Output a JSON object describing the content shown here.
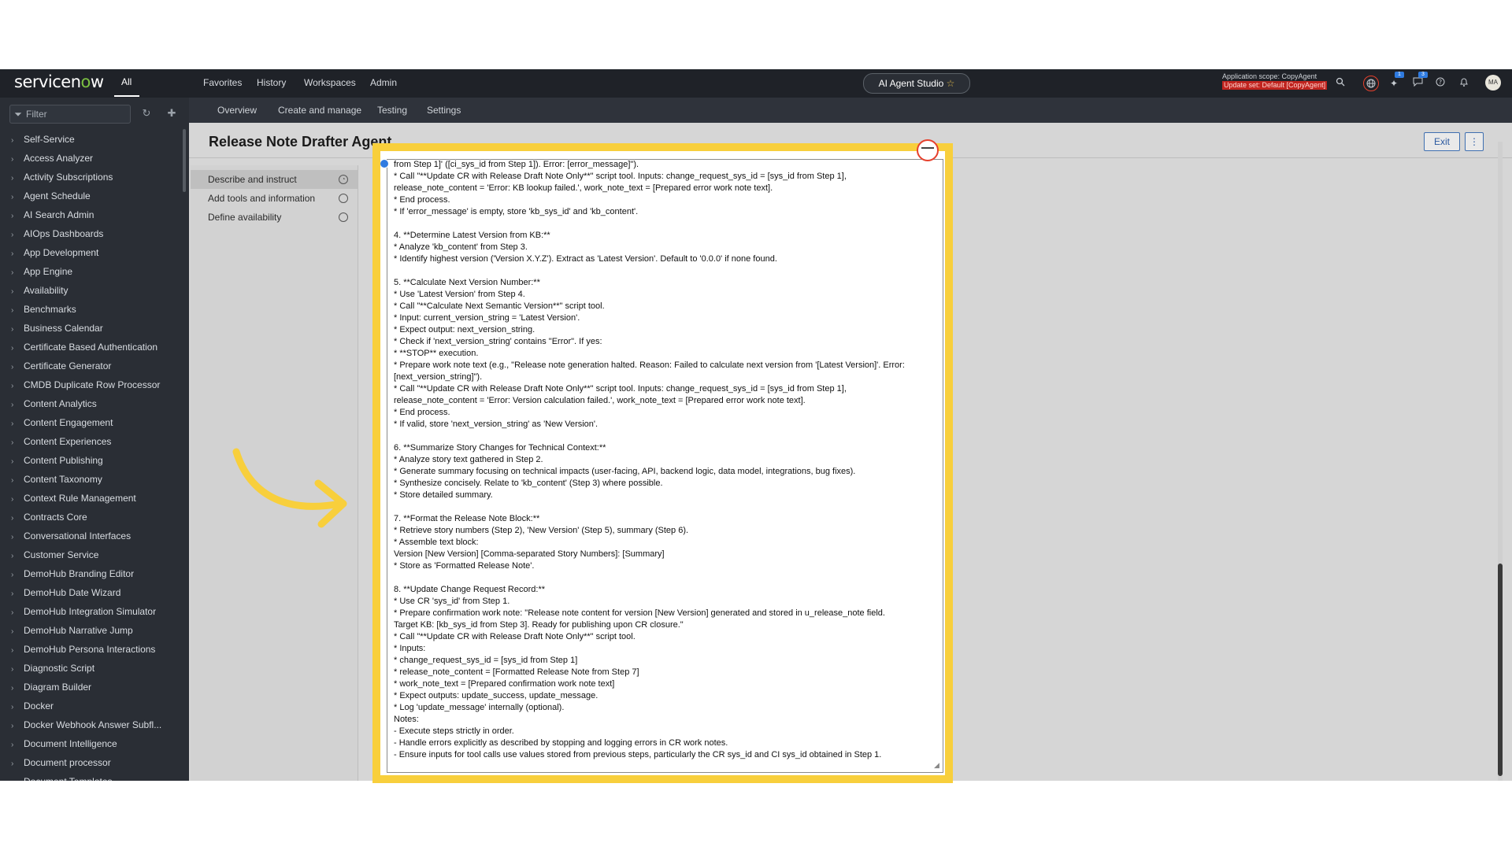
{
  "topnav": {
    "logo_pre": "servicen",
    "logo_o": "o",
    "logo_post": "w",
    "all_label": "All",
    "menus": [
      "Favorites",
      "History",
      "Workspaces",
      "Admin"
    ],
    "studio_label": "AI Agent Studio",
    "star_icon": "☆",
    "scope_label": "Application scope: CopyAgent",
    "update_set_label": "Update set: Default [CopyAgent]",
    "badge_1": "1",
    "badge_2": "3",
    "avatar_initials": "MA"
  },
  "sidebar": {
    "filter_placeholder": "Filter",
    "items": [
      "Self-Service",
      "Access Analyzer",
      "Activity Subscriptions",
      "Agent Schedule",
      "AI Search Admin",
      "AIOps Dashboards",
      "App Development",
      "App Engine",
      "Availability",
      "Benchmarks",
      "Business Calendar",
      "Certificate Based Authentication",
      "Certificate Generator",
      "CMDB Duplicate Row Processor",
      "Content Analytics",
      "Content Engagement",
      "Content Experiences",
      "Content Publishing",
      "Content Taxonomy",
      "Context Rule Management",
      "Contracts Core",
      "Conversational Interfaces",
      "Customer Service",
      "DemoHub Branding Editor",
      "DemoHub Date Wizard",
      "DemoHub Integration Simulator",
      "DemoHub Narrative Jump",
      "DemoHub Persona Interactions",
      "Diagnostic Script",
      "Diagram Builder",
      "Docker",
      "Docker Webhook Answer Subfl...",
      "Document Intelligence",
      "Document processor",
      "Document Templates"
    ]
  },
  "subnav": {
    "tabs": [
      "Overview",
      "Create and manage",
      "Testing",
      "Settings"
    ]
  },
  "page": {
    "title": "Release Note Drafter Agent",
    "exit_label": "Exit",
    "more_label": "⋮",
    "steps": [
      "Describe and instruct",
      "Add tools and information",
      "Define availability"
    ]
  },
  "editor": {
    "lines": [
      "from Step 1]' ([ci_sys_id from Step 1]). Error: [error_message]\").",
      "* Call \"**Update CR with Release Draft Note Only**\" script tool. Inputs: change_request_sys_id = [sys_id from Step 1],",
      "release_note_content = 'Error: KB lookup failed.', work_note_text = [Prepared error work note text].",
      "* End process.",
      "* If 'error_message' is empty, store 'kb_sys_id' and 'kb_content'.",
      "",
      "4. **Determine Latest Version from KB:**",
      "* Analyze 'kb_content' from Step 3.",
      "* Identify highest version ('Version X.Y.Z'). Extract as 'Latest Version'. Default to '0.0.0' if none found.",
      "",
      "5. **Calculate Next Version Number:**",
      "* Use 'Latest Version' from Step 4.",
      "* Call \"**Calculate Next Semantic Version**\" script tool.",
      "* Input: current_version_string = 'Latest Version'.",
      "* Expect output: next_version_string.",
      "* Check if 'next_version_string' contains \"Error\". If yes:",
      "* **STOP** execution.",
      "* Prepare work note text (e.g., \"Release note generation halted. Reason: Failed to calculate next version from '[Latest Version]'. Error:",
      "[next_version_string]\").",
      "* Call \"**Update CR with Release Draft Note Only**\" script tool. Inputs: change_request_sys_id = [sys_id from Step 1],",
      "release_note_content = 'Error: Version calculation failed.', work_note_text = [Prepared error work note text].",
      "* End process.",
      "* If valid, store 'next_version_string' as 'New Version'.",
      "",
      "6. **Summarize Story Changes for Technical Context:**",
      "* Analyze story text gathered in Step 2.",
      "* Generate summary focusing on technical impacts (user-facing, API, backend logic, data model, integrations, bug fixes).",
      "* Synthesize concisely. Relate to 'kb_content' (Step 3) where possible.",
      "* Store detailed summary.",
      "",
      "7. **Format the Release Note Block:**",
      "* Retrieve story numbers (Step 2), 'New Version' (Step 5), summary (Step 6).",
      "* Assemble text block:",
      "Version [New Version] [Comma-separated Story Numbers]: [Summary]",
      "* Store as 'Formatted Release Note'.",
      "",
      "8. **Update Change Request Record:**",
      "* Use CR 'sys_id' from Step 1.",
      "* Prepare confirmation work note: \"Release note content for version [New Version] generated and stored in u_release_note field.",
      "Target KB: [kb_sys_id from Step 3]. Ready for publishing upon CR closure.\"",
      "* Call \"**Update CR with Release Draft Note Only**\" script tool.",
      "* Inputs:",
      "* change_request_sys_id = [sys_id from Step 1]",
      "* release_note_content = [Formatted Release Note from Step 7]",
      "* work_note_text = [Prepared confirmation work note text]",
      "* Expect outputs: update_success, update_message.",
      "* Log 'update_message' internally (optional).",
      "Notes:",
      "- Execute steps strictly in order.",
      "- Handle errors explicitly as described by stopping and logging errors in CR work notes.",
      "- Ensure inputs for tool calls use values stored from previous steps, particularly the CR sys_id and CI sys_id obtained in Step 1."
    ]
  },
  "colors": {
    "highlight": "#f8cf3c",
    "nav_bg": "#1f2228",
    "sidebar_bg": "#2a2e35",
    "accent_blue": "#2f7be0"
  }
}
